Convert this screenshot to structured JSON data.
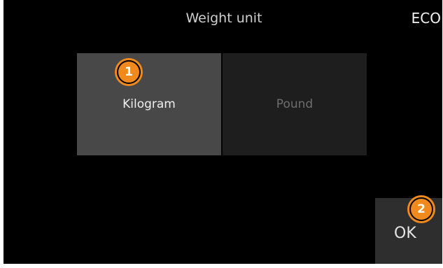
{
  "header": {
    "title": "Weight unit",
    "mode_label": "ECO"
  },
  "options": [
    {
      "label": "Kilogram",
      "selected": true
    },
    {
      "label": "Pound",
      "selected": false
    }
  ],
  "ok_button": {
    "label": "OK"
  },
  "callouts": [
    {
      "number": "1"
    },
    {
      "number": "2"
    }
  ],
  "colors": {
    "background": "#000000",
    "selected_option": "#484848",
    "unselected_option": "#1e1e1e",
    "callout": "#f08a1c"
  }
}
